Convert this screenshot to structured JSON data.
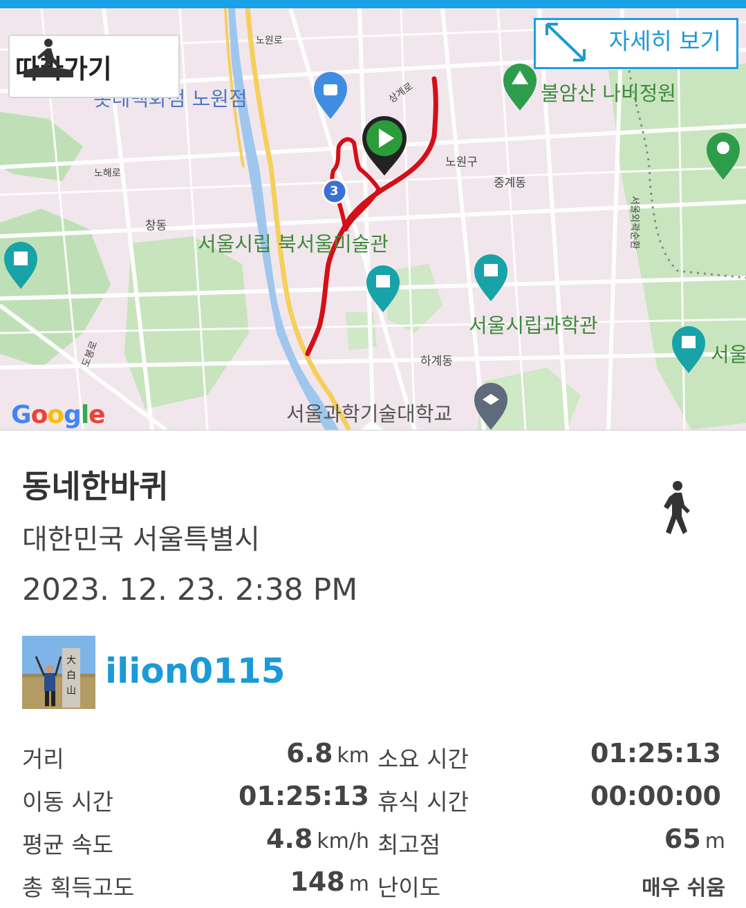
{
  "map": {
    "follow_button_label": "따라가기",
    "detail_button_label": "자세히 보기",
    "labels": {
      "dept_store": "롯데백화점 노원점",
      "arboretum": "불암산 나비정원",
      "museum": "서울시립 북서울미술관",
      "science_museum": "서울시립과학관",
      "university": "서울과학기술대학교",
      "seoul_right": "서울",
      "nowon_gu": "노원구",
      "junggye": "중계동",
      "hagye": "하계동",
      "changdong": "창동",
      "nowon_ro": "노원로",
      "sanggyero": "상계로",
      "nohae_ro": "노해로",
      "dobong_ro": "도봉로",
      "seoulwe": "서울외곽순환",
      "route_badge": "3"
    },
    "google_logo": "Google"
  },
  "track": {
    "title": "동네한바퀴",
    "region": "대한민국 서울특별시",
    "datetime": "2023. 12. 23. 2:38 PM",
    "activity_icon": "walking-person-icon",
    "username": "ilion0115"
  },
  "stats": {
    "distance_label": "거리",
    "distance_value": "6.8",
    "distance_unit": "km",
    "duration_label": "소요 시간",
    "duration_value": "01:25:13",
    "moving_label": "이동 시간",
    "moving_value": "01:25:13",
    "rest_label": "휴식 시간",
    "rest_value": "00:00:00",
    "avg_speed_label": "평균 속도",
    "avg_speed_value": "4.8",
    "avg_speed_unit": "km/h",
    "max_elev_label": "최고점",
    "max_elev_value": "65",
    "max_elev_unit": "m",
    "total_ascent_label": "총 획득고도",
    "total_ascent_value": "148",
    "total_ascent_unit": "m",
    "difficulty_label": "난이도",
    "difficulty_value": "매우 쉬움"
  },
  "colors": {
    "accent": "#1aa0e6",
    "track_line": "#d30f17",
    "start_marker": "#2a9d3a",
    "text": "#444444"
  }
}
